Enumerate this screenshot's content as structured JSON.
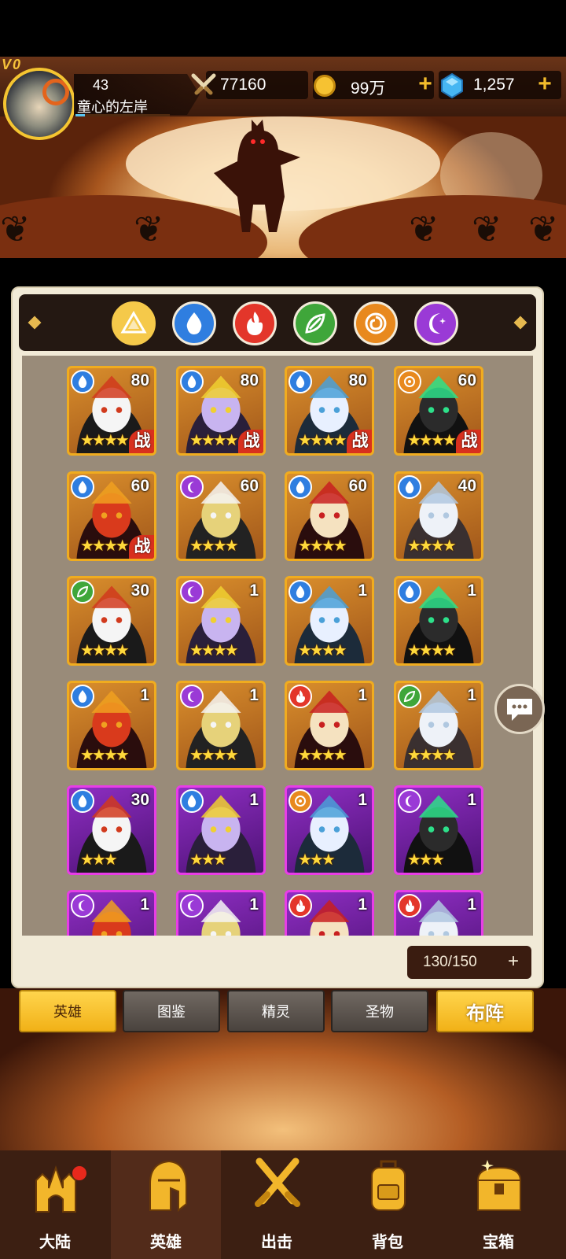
{
  "player": {
    "vip": "V0",
    "level": "43",
    "name": "童心的左岸"
  },
  "resources": {
    "power": "77160",
    "gold": "99万",
    "gems": "1,257"
  },
  "element_filters": [
    {
      "name": "all",
      "color": "#f5c94a"
    },
    {
      "name": "water",
      "color": "#2f7ee0"
    },
    {
      "name": "fire",
      "color": "#e3362a"
    },
    {
      "name": "wind",
      "color": "#3fa63a"
    },
    {
      "name": "sun",
      "color": "#e8891e"
    },
    {
      "name": "moon",
      "color": "#9a3ad6"
    }
  ],
  "heroes": [
    {
      "level": "80",
      "element": "water",
      "stars": "★★★★",
      "in_battle": true,
      "frame": "gold",
      "in_battle_label": "战"
    },
    {
      "level": "80",
      "element": "water",
      "stars": "★★★★",
      "in_battle": true,
      "frame": "gold",
      "in_battle_label": "战"
    },
    {
      "level": "80",
      "element": "water",
      "stars": "★★★★",
      "in_battle": true,
      "frame": "gold",
      "in_battle_label": "战"
    },
    {
      "level": "60",
      "element": "sun",
      "stars": "★★★★",
      "in_battle": true,
      "frame": "gold",
      "in_battle_label": "战"
    },
    {
      "level": "60",
      "element": "water",
      "stars": "★★★★",
      "in_battle": true,
      "frame": "gold",
      "in_battle_label": "战"
    },
    {
      "level": "60",
      "element": "moon",
      "stars": "★★★★",
      "in_battle": false,
      "frame": "gold"
    },
    {
      "level": "60",
      "element": "water",
      "stars": "★★★★",
      "in_battle": false,
      "frame": "gold"
    },
    {
      "level": "40",
      "element": "water",
      "stars": "★★★★",
      "in_battle": false,
      "frame": "gold"
    },
    {
      "level": "30",
      "element": "wind",
      "stars": "★★★★",
      "in_battle": false,
      "frame": "gold"
    },
    {
      "level": "1",
      "element": "moon",
      "stars": "★★★★",
      "in_battle": false,
      "frame": "gold"
    },
    {
      "level": "1",
      "element": "water",
      "stars": "★★★★",
      "in_battle": false,
      "frame": "gold"
    },
    {
      "level": "1",
      "element": "water",
      "stars": "★★★★",
      "in_battle": false,
      "frame": "gold"
    },
    {
      "level": "1",
      "element": "water",
      "stars": "★★★★",
      "in_battle": false,
      "frame": "gold"
    },
    {
      "level": "1",
      "element": "moon",
      "stars": "★★★★",
      "in_battle": false,
      "frame": "gold"
    },
    {
      "level": "1",
      "element": "fire",
      "stars": "★★★★",
      "in_battle": false,
      "frame": "gold"
    },
    {
      "level": "1",
      "element": "wind",
      "stars": "★★★★",
      "in_battle": false,
      "frame": "gold"
    },
    {
      "level": "30",
      "element": "water",
      "stars": "★★★",
      "in_battle": false,
      "frame": "purple"
    },
    {
      "level": "1",
      "element": "water",
      "stars": "★★★",
      "in_battle": false,
      "frame": "purple"
    },
    {
      "level": "1",
      "element": "sun",
      "stars": "★★★",
      "in_battle": false,
      "frame": "purple"
    },
    {
      "level": "1",
      "element": "moon",
      "stars": "★★★",
      "in_battle": false,
      "frame": "purple"
    },
    {
      "level": "1",
      "element": "moon",
      "stars": "",
      "in_battle": false,
      "frame": "purple"
    },
    {
      "level": "1",
      "element": "moon",
      "stars": "",
      "in_battle": false,
      "frame": "purple"
    },
    {
      "level": "1",
      "element": "fire",
      "stars": "",
      "in_battle": false,
      "frame": "purple"
    },
    {
      "level": "1",
      "element": "fire",
      "stars": "",
      "in_battle": false,
      "frame": "purple"
    }
  ],
  "capacity": {
    "text": "130/150",
    "plus": "+"
  },
  "tabs": {
    "heroes": "英雄",
    "codex": "图鉴",
    "spirit": "精灵",
    "relic": "圣物",
    "formation": "布阵"
  },
  "nav": {
    "continent": "大陆",
    "heroes": "英雄",
    "battle": "出击",
    "bag": "背包",
    "chest": "宝箱"
  },
  "colors": {
    "accent_gold": "#f3bc2b",
    "legendary_frame": "#f0ac1f",
    "epic_frame": "#e83de6",
    "nav_bg": "#3c1f12"
  }
}
